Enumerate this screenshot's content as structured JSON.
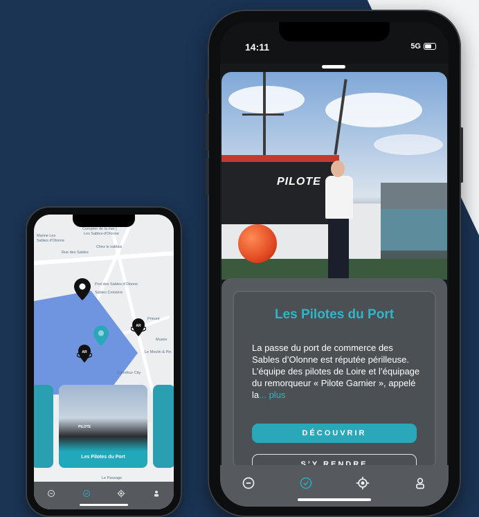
{
  "colors": {
    "background": "#1b3454",
    "accent": "#2fb6c8",
    "button": "#2aa7b9",
    "card": "#4b5054",
    "tabbar": "#565a5e"
  },
  "big_phone": {
    "status": {
      "time": "14:11",
      "network": "5G"
    },
    "photo": {
      "boat_label": "PILOTE"
    },
    "card": {
      "title": "Les Pilotes du Port",
      "description": "La passe du port de commerce des Sables d’Olonne est réputée périlleuse. L’équipe des pilotes de Loire et l’équipage du remorqueur « Pilote Garnier », appelé la",
      "more": "... plus",
      "discover_button": "DÉCOUVRIR",
      "go_button": "S’Y RENDRE"
    },
    "tabbar": [
      "map-icon",
      "check-icon",
      "locate-icon",
      "profile-icon"
    ]
  },
  "small_phone": {
    "map_labels": [
      "Comptoir de la mer |",
      "Les Sables-d'Olonne",
      "Marine Les",
      "Sables d'Olonne",
      "Chez le sablais",
      "Rue des Sables",
      "Port des Sables d'Olonne",
      "Sables Croisière",
      "Prieuré",
      "Le Moulin & Pin",
      "Musée",
      "Carrefour City",
      "Le Passage"
    ],
    "carousel": {
      "card_title": "Les Pilotes du Port",
      "boat_label": "PILOTE"
    },
    "tabbar": [
      "map-icon",
      "check-icon",
      "locate-icon",
      "profile-icon"
    ]
  }
}
